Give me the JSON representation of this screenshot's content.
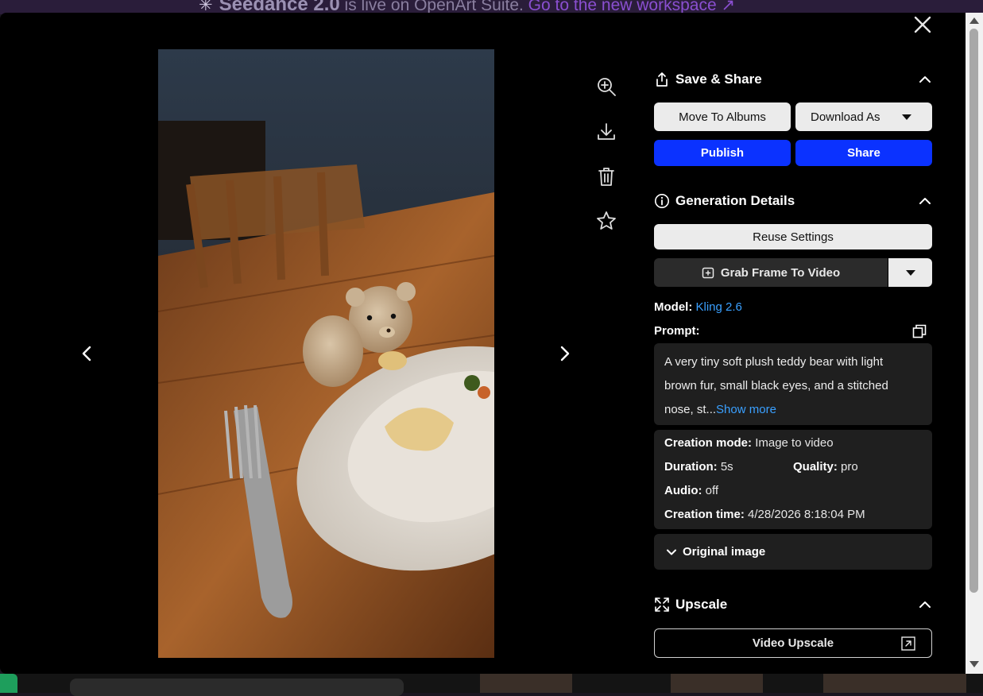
{
  "banner": {
    "brand": "Seedance 2.0",
    "text": " is live on OpenArt Suite. ",
    "link": "Go to the new workspace ↗"
  },
  "save_share": {
    "title": "Save & Share",
    "move_to_albums": "Move To Albums",
    "download_as": "Download As",
    "publish": "Publish",
    "share": "Share"
  },
  "generation": {
    "title": "Generation Details",
    "reuse_settings": "Reuse Settings",
    "grab_frame": "Grab Frame To Video",
    "model_label": "Model:",
    "model_value": "Kling 2.6",
    "prompt_label": "Prompt:",
    "prompt_text": "A very tiny soft plush teddy bear with light brown fur, small black eyes, and a stitched nose, st...",
    "show_more": "Show more",
    "creation_mode_label": "Creation mode:",
    "creation_mode_value": "Image to video",
    "duration_label": "Duration:",
    "duration_value": "5s",
    "quality_label": "Quality:",
    "quality_value": "pro",
    "audio_label": "Audio:",
    "audio_value": "off",
    "creation_time_label": "Creation time:",
    "creation_time_value": "4/28/2026 8:18:04 PM",
    "original_image": "Original image"
  },
  "upscale": {
    "title": "Upscale",
    "video_upscale": "Video Upscale"
  },
  "colors": {
    "accent_blue": "#0b32ff",
    "link_blue": "#3aa0ff",
    "panel_bg": "#1f1f1f"
  },
  "icons": [
    "close-icon",
    "zoom-in-icon",
    "download-icon",
    "trash-icon",
    "star-icon",
    "chevron-left-icon",
    "chevron-right-icon",
    "share-icon",
    "info-icon",
    "expand-icon",
    "copy-icon",
    "external-link-icon",
    "chevron-up-icon",
    "chevron-down-icon",
    "add-frame-icon"
  ]
}
